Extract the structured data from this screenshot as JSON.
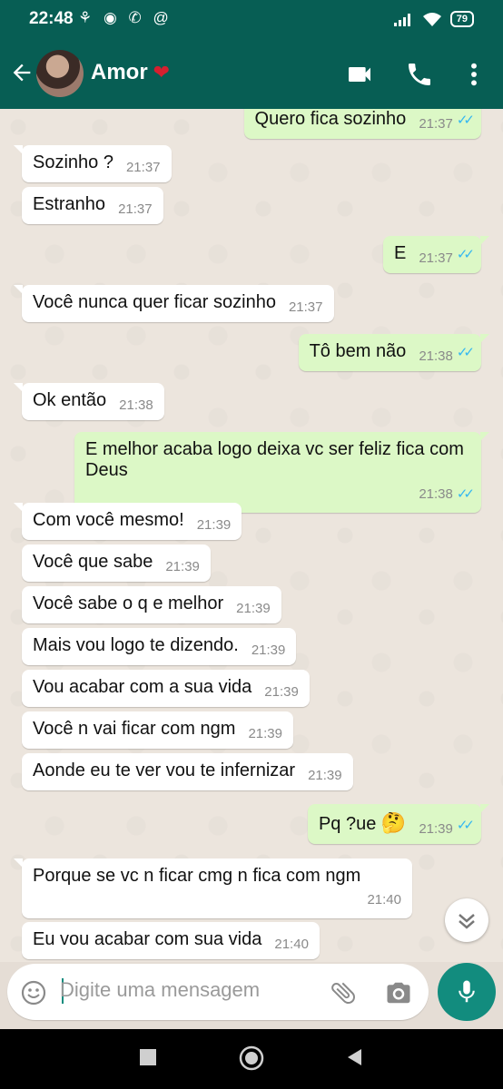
{
  "status_bar": {
    "time": "22:48",
    "notif_icons": "⚘ ◉ ✆ @",
    "battery": "79"
  },
  "header": {
    "contact_name": "Amor",
    "heart": "❤"
  },
  "messages": [
    {
      "dir": "out",
      "text": "Quero fica sozinho",
      "time": "21:37",
      "status": "read"
    },
    {
      "dir": "in",
      "text": "Sozinho ?",
      "time": "21:37"
    },
    {
      "dir": "in",
      "text": "Estranho",
      "time": "21:37"
    },
    {
      "dir": "out",
      "text": "E",
      "time": "21:37",
      "status": "read"
    },
    {
      "dir": "in",
      "text": "Você nunca quer ficar sozinho",
      "time": "21:37"
    },
    {
      "dir": "out",
      "text": "Tô bem não",
      "time": "21:38",
      "status": "read"
    },
    {
      "dir": "in",
      "text": "Ok então",
      "time": "21:38"
    },
    {
      "dir": "out",
      "text": "E melhor acaba logo deixa vc ser feliz fica com Deus",
      "time": "21:38",
      "status": "read"
    },
    {
      "dir": "in",
      "text": "Com você mesmo!",
      "time": "21:39"
    },
    {
      "dir": "in",
      "text": "Você que sabe",
      "time": "21:39"
    },
    {
      "dir": "in",
      "text": "Você sabe o q e melhor",
      "time": "21:39"
    },
    {
      "dir": "in",
      "text": "Mais vou logo te dizendo.",
      "time": "21:39"
    },
    {
      "dir": "in",
      "text": "Vou acabar com a sua vida",
      "time": "21:39"
    },
    {
      "dir": "in",
      "text": "Você n vai ficar com ngm",
      "time": "21:39"
    },
    {
      "dir": "in",
      "text": "Aonde eu te ver vou te infernizar",
      "time": "21:39"
    },
    {
      "dir": "out",
      "text": "Pq ?ue",
      "emoji": "🤔",
      "time": "21:39",
      "status": "read"
    },
    {
      "dir": "in",
      "text": "Porque se vc n ficar cmg n fica com ngm",
      "time": "21:40"
    },
    {
      "dir": "in",
      "text": "Eu vou acabar com sua vida",
      "time": "21:40"
    }
  ],
  "composer": {
    "placeholder": "Digite uma mensagem"
  },
  "colors": {
    "header": "#075e54",
    "outgoing_bubble": "#dcf8c6",
    "incoming_bubble": "#ffffff",
    "accent": "#128c7e",
    "read_ticks": "#34b7f1"
  },
  "icons": [
    "back-arrow-icon",
    "video-call-icon",
    "phone-icon",
    "more-vert-icon",
    "emoji-icon",
    "attach-icon",
    "camera-icon",
    "mic-icon",
    "chevron-down-icon"
  ]
}
